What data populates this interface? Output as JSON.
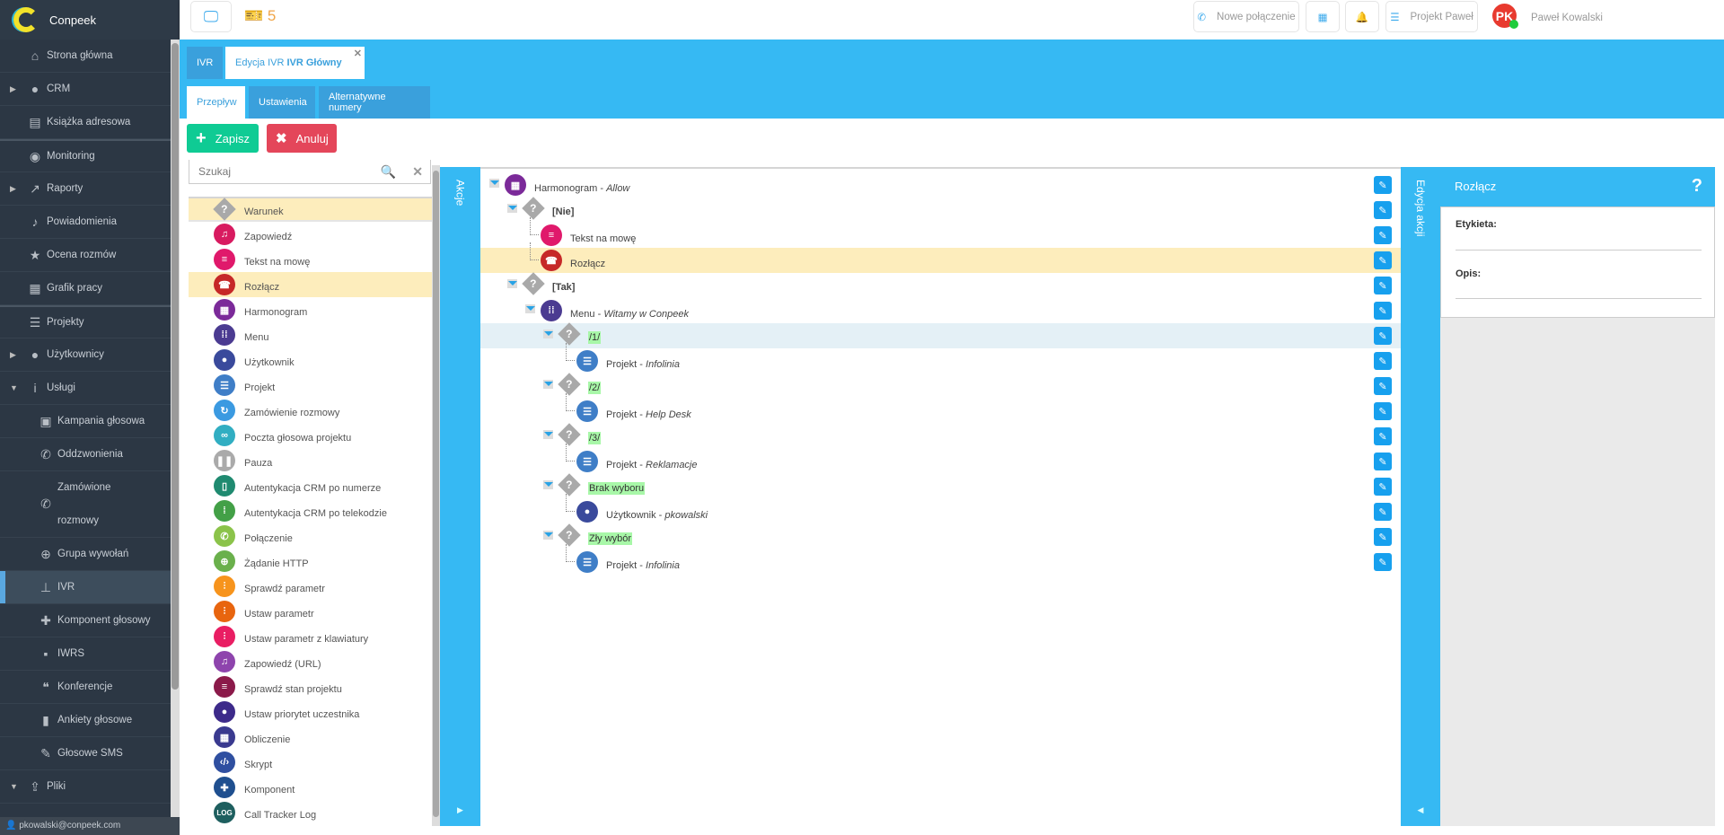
{
  "app": {
    "name": "Conpeek",
    "user_email": "pkowalski@conpeek.com"
  },
  "topbar": {
    "ticket_count": "5",
    "new_call": "Nowe połączenie",
    "project": "Projekt Paweł",
    "avatar_initials": "PK",
    "user_name": "Paweł Kowalski"
  },
  "sidebar": [
    {
      "label": "Strona główna",
      "icon": "home-icon",
      "glyph": "⌂"
    },
    {
      "label": "CRM",
      "icon": "user-icon",
      "glyph": "●",
      "arrow": "▶"
    },
    {
      "label": "Książka adresowa",
      "icon": "address-card-icon",
      "glyph": "▤"
    },
    {
      "label": "Monitoring",
      "icon": "eye-icon",
      "glyph": "◉"
    },
    {
      "label": "Raporty",
      "icon": "chart-line-icon",
      "glyph": "↗",
      "arrow": "▶"
    },
    {
      "label": "Powiadomienia",
      "icon": "bell-icon",
      "glyph": "♪"
    },
    {
      "label": "Ocena rozmów",
      "icon": "star-icon",
      "glyph": "★"
    },
    {
      "label": "Grafik pracy",
      "icon": "calendar-icon",
      "glyph": "▦"
    },
    {
      "label": "Projekty",
      "icon": "tasks-icon",
      "glyph": "☰"
    },
    {
      "label": "Użytkownicy",
      "icon": "user-icon",
      "glyph": "●",
      "arrow": "▶"
    },
    {
      "label": "Usługi",
      "icon": "info-icon",
      "glyph": "i",
      "arrow": "▼"
    },
    {
      "label": "Kampania głosowa",
      "icon": "contact-icon",
      "glyph": "▣",
      "sub": true
    },
    {
      "label": "Oddzwonienia",
      "icon": "phone-icon",
      "glyph": "✆",
      "sub": true
    },
    {
      "label": "Zamówione rozmowy",
      "icon": "phone-volume-icon",
      "glyph": "✆",
      "sub": true,
      "tall": true
    },
    {
      "label": "Grupa wywołań",
      "icon": "crosshairs-icon",
      "glyph": "⊕",
      "sub": true
    },
    {
      "label": "IVR",
      "icon": "sitemap-icon",
      "glyph": "⊥",
      "sub": true,
      "active": true
    },
    {
      "label": "Komponent głosowy",
      "icon": "puzzle-icon",
      "glyph": "✚",
      "sub": true
    },
    {
      "label": "IWRS",
      "icon": "comment-icon",
      "glyph": "▪",
      "sub": true
    },
    {
      "label": "Konferencje",
      "icon": "comments-icon",
      "glyph": "❝",
      "sub": true
    },
    {
      "label": "Ankiety głosowe",
      "icon": "bar-chart-icon",
      "glyph": "▮",
      "sub": true
    },
    {
      "label": "Głosowe SMS",
      "icon": "mic-icon",
      "glyph": "✎",
      "sub": true
    },
    {
      "label": "Pliki",
      "icon": "upload-icon",
      "glyph": "⇪",
      "arrow": "▼"
    }
  ],
  "tabs": {
    "ivr": "IVR",
    "edit_prefix": "Edycja IVR ",
    "edit_name": "IVR Główny",
    "close": "✕"
  },
  "subtabs": [
    "Przepływ",
    "Ustawienia",
    "Alternatywne numery"
  ],
  "buttons": {
    "save": "Zapisz",
    "cancel": "Anuluj"
  },
  "search": {
    "placeholder": "Szukaj"
  },
  "strips": {
    "actions": "Akcje",
    "edit_action": "Edycja akcji"
  },
  "actions": [
    {
      "label": "Warunek",
      "type": "diamond",
      "hl": true
    },
    {
      "label": "Zapowiedź",
      "color": "#d81b60",
      "glyph": "♫"
    },
    {
      "label": "Tekst na mowę",
      "color": "#e0196b",
      "glyph": "≡"
    },
    {
      "label": "Rozłącz",
      "color": "#c62828",
      "glyph": "☎",
      "hl": true
    },
    {
      "label": "Harmonogram",
      "color": "#7b2a99",
      "glyph": "▦"
    },
    {
      "label": "Menu",
      "color": "#4b3b91",
      "glyph": "⁞⁞"
    },
    {
      "label": "Użytkownik",
      "color": "#3a4a9c",
      "glyph": "●"
    },
    {
      "label": "Projekt",
      "color": "#3f7ec7",
      "glyph": "☰"
    },
    {
      "label": "Zamówienie rozmowy",
      "color": "#3b9ae1",
      "glyph": "↻"
    },
    {
      "label": "Poczta głosowa projektu",
      "color": "#31aec2",
      "glyph": "∞"
    },
    {
      "label": "Pauza",
      "color": "#aaaaaa",
      "glyph": "❚❚"
    },
    {
      "label": "Autentykacja CRM po numerze",
      "color": "#1f8a70",
      "glyph": "▯"
    },
    {
      "label": "Autentykacja CRM po telekodzie",
      "color": "#43a047",
      "glyph": "⁞"
    },
    {
      "label": "Połączenie",
      "color": "#8bc34a",
      "glyph": "✆"
    },
    {
      "label": "Żądanie HTTP",
      "color": "#6ab04c",
      "glyph": "⊕"
    },
    {
      "label": "Sprawdź parametr",
      "color": "#f7941d",
      "glyph": "⫶"
    },
    {
      "label": "Ustaw parametr",
      "color": "#e8650f",
      "glyph": "⫶"
    },
    {
      "label": "Ustaw parametr z klawiatury",
      "color": "#e91e63",
      "glyph": "⫶"
    },
    {
      "label": "Zapowiedź (URL)",
      "color": "#8e44ad",
      "glyph": "♫"
    },
    {
      "label": "Sprawdź stan projektu",
      "color": "#8b1a4a",
      "glyph": "≡"
    },
    {
      "label": "Ustaw priorytet uczestnika",
      "color": "#3d2a8a",
      "glyph": "●"
    },
    {
      "label": "Obliczenie",
      "color": "#3a3a8f",
      "glyph": "▦"
    },
    {
      "label": "Skrypt",
      "color": "#2f4fa0",
      "glyph": "‹/›"
    },
    {
      "label": "Komponent",
      "color": "#1f4f8f",
      "glyph": "✚"
    },
    {
      "label": "Call Tracker Log",
      "color": "#1e5f5f",
      "glyph": "LOG"
    }
  ],
  "tree": [
    {
      "level": 0,
      "toggle": true,
      "color": "#7b2a99",
      "glyph": "▦",
      "name": "Harmonogram",
      "detail": "Allow"
    },
    {
      "level": 1,
      "toggle": true,
      "type": "diamond",
      "name": "[Nie]",
      "bold": true
    },
    {
      "level": 2,
      "color": "#e0196b",
      "glyph": "≡",
      "name": "Tekst na mowę"
    },
    {
      "level": 2,
      "color": "#c62828",
      "glyph": "☎",
      "name": "Rozłącz",
      "hl": true
    },
    {
      "level": 1,
      "toggle": true,
      "type": "diamond",
      "name": "[Tak]",
      "bold": true
    },
    {
      "level": 2,
      "toggle": true,
      "color": "#4b3b91",
      "glyph": "⁞⁞",
      "name": "Menu",
      "detail": "Witamy w Conpeek"
    },
    {
      "level": 3,
      "toggle": true,
      "type": "diamond",
      "name": "/1/",
      "green": true,
      "sel": true
    },
    {
      "level": 4,
      "color": "#3f7ec7",
      "glyph": "☰",
      "name": "Projekt",
      "detail": "Infolinia"
    },
    {
      "level": 3,
      "toggle": true,
      "type": "diamond",
      "name": "/2/",
      "green": true
    },
    {
      "level": 4,
      "color": "#3f7ec7",
      "glyph": "☰",
      "name": "Projekt",
      "detail": "Help Desk"
    },
    {
      "level": 3,
      "toggle": true,
      "type": "diamond",
      "name": "/3/",
      "green": true
    },
    {
      "level": 4,
      "color": "#3f7ec7",
      "glyph": "☰",
      "name": "Projekt",
      "detail": "Reklamacje"
    },
    {
      "level": 3,
      "toggle": true,
      "type": "diamond",
      "name": "Brak wyboru",
      "green": true
    },
    {
      "level": 4,
      "color": "#3a4a9c",
      "glyph": "●",
      "name": "Użytkownik",
      "detail": "pkowalski"
    },
    {
      "level": 3,
      "toggle": true,
      "type": "diamond",
      "name": "Zły wybór",
      "green": true
    },
    {
      "level": 4,
      "color": "#3f7ec7",
      "glyph": "☰",
      "name": "Projekt",
      "detail": "Infolinia"
    }
  ],
  "edit_panel": {
    "title": "Rozłącz",
    "help": "?",
    "label_field": "Etykieta:",
    "desc_field": "Opis:"
  }
}
